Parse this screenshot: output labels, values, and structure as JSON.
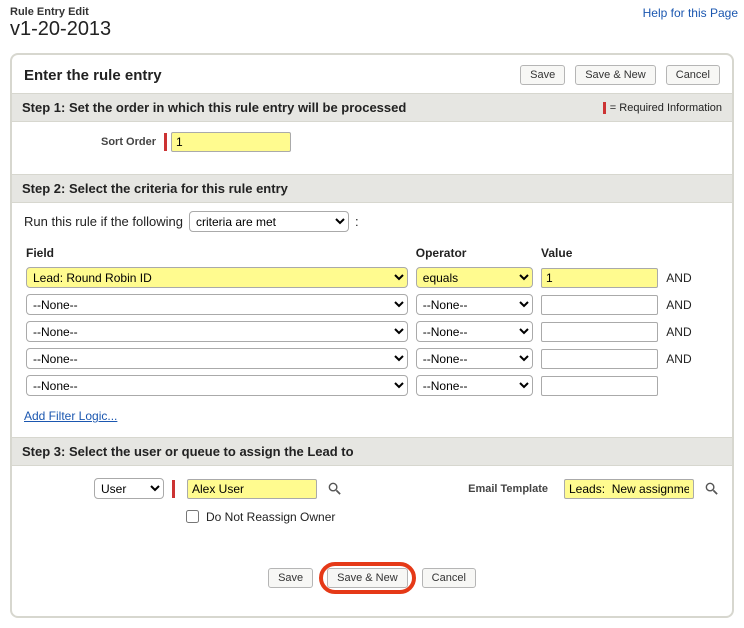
{
  "header": {
    "small_title": "Rule Entry Edit",
    "big_title": "v1-20-2013",
    "help_link": "Help for this Page"
  },
  "enter_title": "Enter the rule entry",
  "buttons": {
    "save": "Save",
    "save_new": "Save & New",
    "cancel": "Cancel"
  },
  "required_info": "= Required Information",
  "step1": {
    "title": "Step 1: Set the order in which this rule entry will be processed",
    "sort_label": "Sort Order",
    "sort_value": "1"
  },
  "step2": {
    "title": "Step 2: Select the criteria for this rule entry",
    "run_prefix": "Run this rule if the following",
    "mode": "criteria are met",
    "headers": {
      "field": "Field",
      "operator": "Operator",
      "value": "Value"
    },
    "rows": [
      {
        "field": "Lead: Round Robin ID",
        "op": "equals",
        "val": "1",
        "hl": true,
        "and": true
      },
      {
        "field": "--None--",
        "op": "--None--",
        "val": "",
        "hl": false,
        "and": true
      },
      {
        "field": "--None--",
        "op": "--None--",
        "val": "",
        "hl": false,
        "and": true
      },
      {
        "field": "--None--",
        "op": "--None--",
        "val": "",
        "hl": false,
        "and": true
      },
      {
        "field": "--None--",
        "op": "--None--",
        "val": "",
        "hl": false,
        "and": false
      }
    ],
    "and_label": "AND",
    "add_filter": "Add Filter Logic..."
  },
  "step3": {
    "title": "Step 3: Select the user or queue to assign the Lead to",
    "assignee_type": "User",
    "assignee_name": "Alex User",
    "email_template_label": "Email Template",
    "email_template_value": "Leads:  New assignme",
    "do_not_reassign": "Do Not Reassign Owner"
  }
}
